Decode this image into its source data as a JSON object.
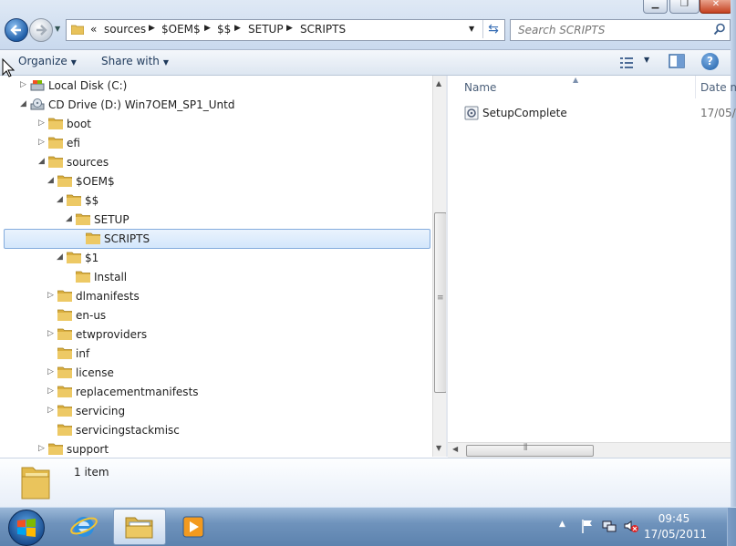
{
  "address_bar": {
    "overflow": "«",
    "crumbs": [
      "sources",
      "$OEM$",
      "$$",
      "SETUP",
      "SCRIPTS"
    ]
  },
  "search": {
    "placeholder": "Search SCRIPTS"
  },
  "toolbar": {
    "organize": "Organize",
    "share_with": "Share with"
  },
  "tree": [
    {
      "label": "Local Disk (C:)",
      "level": 2,
      "expander": "closed",
      "icon": "drive-icon"
    },
    {
      "label": "CD Drive (D:) Win7OEM_SP1_Untd",
      "level": 2,
      "expander": "open",
      "icon": "cd-drive-icon"
    },
    {
      "label": "boot",
      "level": 3,
      "expander": "closed",
      "icon": "folder-icon"
    },
    {
      "label": "efi",
      "level": 3,
      "expander": "closed",
      "icon": "folder-icon"
    },
    {
      "label": "sources",
      "level": 3,
      "expander": "open",
      "icon": "folder-icon"
    },
    {
      "label": "$OEM$",
      "level": 4,
      "expander": "open",
      "icon": "folder-icon"
    },
    {
      "label": "$$",
      "level": 5,
      "expander": "open",
      "icon": "folder-icon"
    },
    {
      "label": "SETUP",
      "level": 6,
      "expander": "open",
      "icon": "folder-icon"
    },
    {
      "label": "SCRIPTS",
      "level": 7,
      "expander": "none",
      "icon": "folder-icon",
      "selected": true
    },
    {
      "label": "$1",
      "level": 5,
      "expander": "open",
      "icon": "folder-icon"
    },
    {
      "label": "Install",
      "level": 6,
      "expander": "none",
      "icon": "folder-icon"
    },
    {
      "label": "dlmanifests",
      "level": 4,
      "expander": "closed",
      "icon": "folder-icon"
    },
    {
      "label": "en-us",
      "level": 4,
      "expander": "none",
      "icon": "folder-icon"
    },
    {
      "label": "etwproviders",
      "level": 4,
      "expander": "closed",
      "icon": "folder-icon"
    },
    {
      "label": "inf",
      "level": 4,
      "expander": "none",
      "icon": "folder-icon"
    },
    {
      "label": "license",
      "level": 4,
      "expander": "closed",
      "icon": "folder-icon"
    },
    {
      "label": "replacementmanifests",
      "level": 4,
      "expander": "closed",
      "icon": "folder-icon"
    },
    {
      "label": "servicing",
      "level": 4,
      "expander": "closed",
      "icon": "folder-icon"
    },
    {
      "label": "servicingstackmisc",
      "level": 4,
      "expander": "none",
      "icon": "folder-icon"
    },
    {
      "label": "support",
      "level": 3,
      "expander": "closed",
      "icon": "folder-icon"
    }
  ],
  "content": {
    "columns": [
      "Name",
      "Date m"
    ],
    "files": [
      {
        "name": "SetupComplete",
        "date": "17/05/",
        "icon": "script-file-icon"
      }
    ]
  },
  "details": {
    "count": "1 item"
  },
  "taskbar": {
    "time": "09:45",
    "date": "17/05/2011"
  },
  "colors": {
    "selection": "#d3e6fb",
    "selection_border": "#84acdd",
    "taskbar": "#6f93bc"
  }
}
